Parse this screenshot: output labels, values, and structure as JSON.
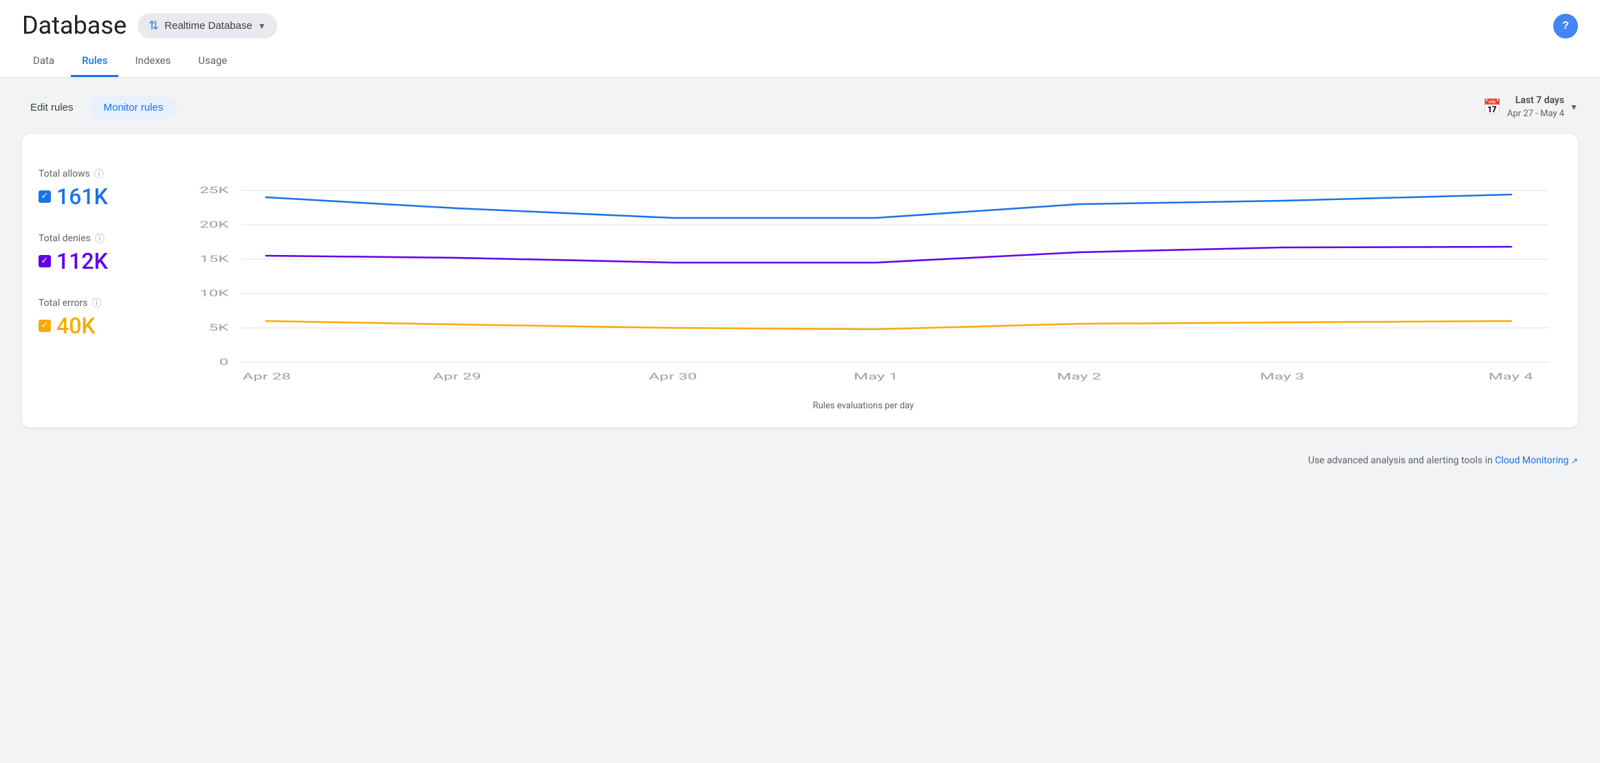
{
  "header": {
    "title": "Database",
    "db_selector_label": "Realtime Database",
    "help_label": "?"
  },
  "tabs": [
    {
      "id": "data",
      "label": "Data",
      "active": false
    },
    {
      "id": "rules",
      "label": "Rules",
      "active": true
    },
    {
      "id": "indexes",
      "label": "Indexes",
      "active": false
    },
    {
      "id": "usage",
      "label": "Usage",
      "active": false
    }
  ],
  "toolbar": {
    "edit_rules_label": "Edit rules",
    "monitor_rules_label": "Monitor rules",
    "date_range_title": "Last 7 days",
    "date_range_sub": "Apr 27 - May 4"
  },
  "chart": {
    "metrics": [
      {
        "id": "allows",
        "label": "Total allows",
        "value": "161K",
        "color_class": "blue",
        "color_hex": "#1a73e8"
      },
      {
        "id": "denies",
        "label": "Total denies",
        "value": "112K",
        "color_class": "purple",
        "color_hex": "#6200ea"
      },
      {
        "id": "errors",
        "label": "Total errors",
        "value": "40K",
        "color_class": "yellow",
        "color_hex": "#f9ab00"
      }
    ],
    "x_labels": [
      "Apr 28",
      "Apr 29",
      "Apr 30",
      "May 1",
      "May 2",
      "May 3",
      "May 4"
    ],
    "y_labels": [
      "25K",
      "20K",
      "15K",
      "10K",
      "5K",
      "0"
    ],
    "x_axis_label": "Rules evaluations per day"
  },
  "footer": {
    "text": "Use advanced analysis and alerting tools in ",
    "link_text": "Cloud Monitoring",
    "link_icon": "↗"
  }
}
